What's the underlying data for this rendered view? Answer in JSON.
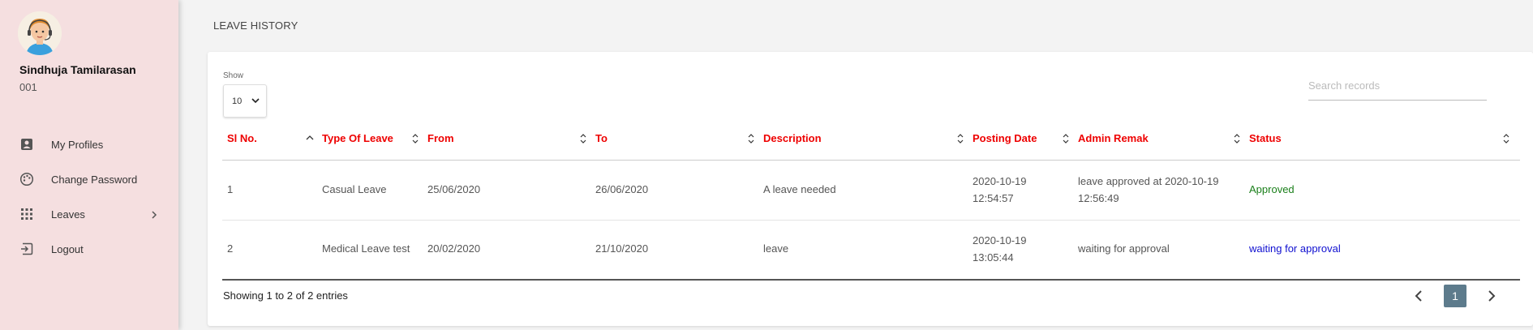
{
  "sidebar": {
    "user_name": "Sindhuja Tamilarasan",
    "user_id": "001",
    "items": [
      {
        "label": "My Profiles",
        "icon": "profile-icon"
      },
      {
        "label": "Change Password",
        "icon": "palette-icon"
      },
      {
        "label": "Leaves",
        "icon": "grid-icon"
      },
      {
        "label": "Logout",
        "icon": "logout-icon"
      }
    ]
  },
  "page": {
    "title": "LEAVE HISTORY"
  },
  "controls": {
    "show_label": "Show",
    "page_size": "10",
    "search_placeholder": "Search records"
  },
  "table": {
    "columns": [
      "Sl No.",
      "Type Of Leave",
      "From",
      "To",
      "Description",
      "Posting Date",
      "Admin Remak",
      "Status"
    ],
    "rows": [
      {
        "sl": "1",
        "type": "Casual Leave",
        "from": "25/06/2020",
        "to": "26/06/2020",
        "description": "A leave needed",
        "posting_date_1": "2020-10-19",
        "posting_date_2": "12:54:57",
        "remark_1": "leave approved at 2020-10-19",
        "remark_2": "12:56:49",
        "status": "Approved"
      },
      {
        "sl": "2",
        "type": "Medical Leave test",
        "from": "20/02/2020",
        "to": "21/10/2020",
        "description": "leave",
        "posting_date_1": "2020-10-19",
        "posting_date_2": "13:05:44",
        "remark_1": "waiting for approval",
        "remark_2": "",
        "status": "waiting for approval"
      }
    ]
  },
  "footer": {
    "entries_text": "Showing 1 to 2 of 2 entries",
    "current_page": "1"
  },
  "colors": {
    "sidebar_bg": "#f5dfe0",
    "header_text": "#ee0000",
    "approved": "#1a7f1a",
    "waiting": "#1010d0",
    "active_page": "#5d7b8c"
  }
}
